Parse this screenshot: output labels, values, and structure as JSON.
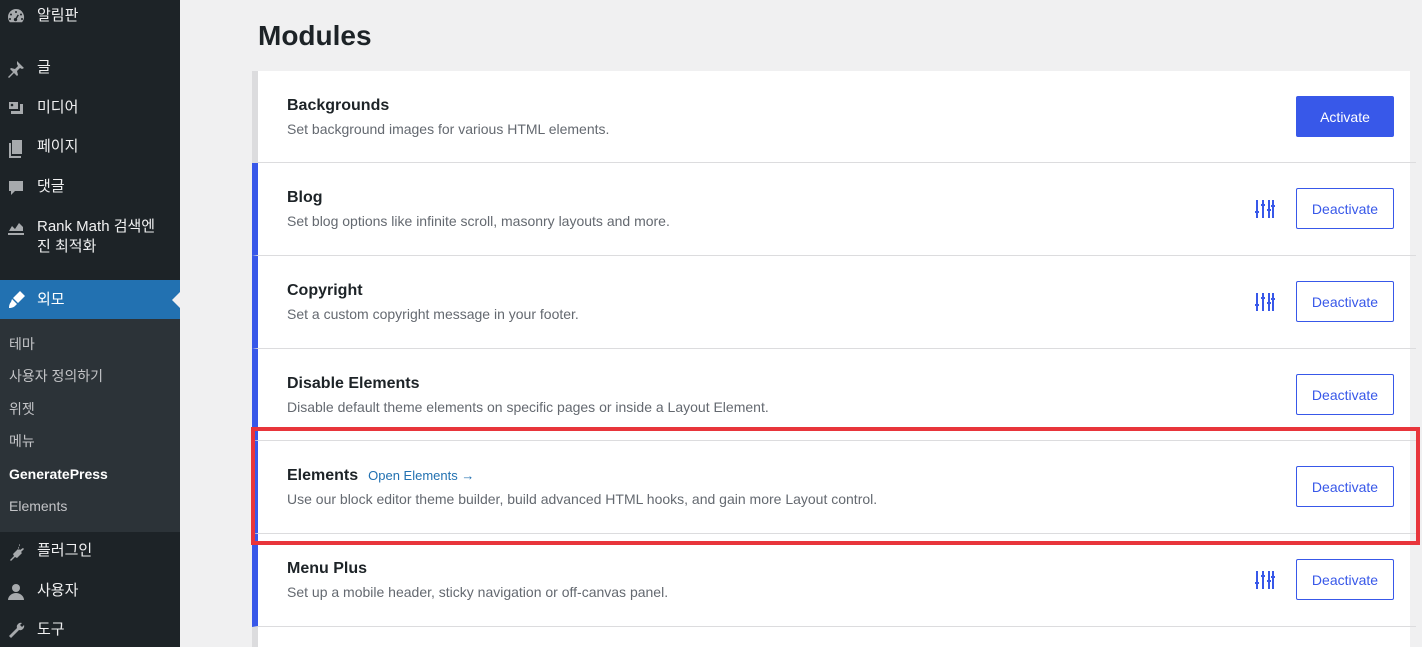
{
  "sidebar": {
    "items": [
      {
        "label": "알림판",
        "icon": "dashboard-icon"
      },
      {
        "label": "글",
        "icon": "pin-icon"
      },
      {
        "label": "미디어",
        "icon": "media-icon"
      },
      {
        "label": "페이지",
        "icon": "pages-icon"
      },
      {
        "label": "댓글",
        "icon": "comments-icon"
      },
      {
        "label": "Rank Math 검색엔\n진 최적화",
        "label_line1": "Rank Math 검색엔",
        "label_line2": "진 최적화",
        "icon": "rank-math-icon"
      },
      {
        "label": "외모",
        "icon": "appearance-icon",
        "active": true
      },
      {
        "label": "플러그인",
        "icon": "plugins-icon"
      },
      {
        "label": "사용자",
        "icon": "users-icon"
      },
      {
        "label": "도구",
        "icon": "tools-icon"
      }
    ],
    "submenu": [
      {
        "label": "테마"
      },
      {
        "label": "사용자 정의하기"
      },
      {
        "label": "위젯"
      },
      {
        "label": "메뉴"
      },
      {
        "label": "GeneratePress",
        "current": true
      },
      {
        "label": "Elements"
      }
    ]
  },
  "main": {
    "title": "Modules",
    "modules": [
      {
        "name": "Backgrounds",
        "description": "Set background images for various HTML elements.",
        "button": "Activate",
        "enabled": false,
        "has_settings": false
      },
      {
        "name": "Blog",
        "description": "Set blog options like infinite scroll, masonry layouts and more.",
        "button": "Deactivate",
        "enabled": true,
        "has_settings": true
      },
      {
        "name": "Copyright",
        "description": "Set a custom copyright message in your footer.",
        "button": "Deactivate",
        "enabled": true,
        "has_settings": true
      },
      {
        "name": "Disable Elements",
        "description": "Disable default theme elements on specific pages or inside a Layout Element.",
        "button": "Deactivate",
        "enabled": true,
        "has_settings": false
      },
      {
        "name": "Elements",
        "link": "Open Elements →",
        "description": "Use our block editor theme builder, build advanced HTML hooks, and gain more Layout control.",
        "button": "Deactivate",
        "enabled": true,
        "has_settings": false
      },
      {
        "name": "Menu Plus",
        "description": "Set up a mobile header, sticky navigation or off-canvas panel.",
        "button": "Deactivate",
        "enabled": true,
        "has_settings": true
      }
    ]
  },
  "colors": {
    "accent": "#3858e9",
    "sidebar_bg": "#1d2327",
    "active_menu": "#2271b1",
    "highlight": "#e8353b"
  }
}
